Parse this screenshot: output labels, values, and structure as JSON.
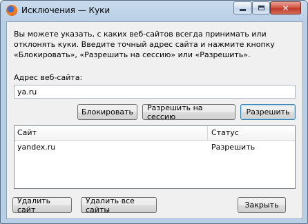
{
  "window": {
    "title": "Исключения — Куки"
  },
  "description": "Вы можете указать, с каких веб-сайтов всегда принимать или отклонять куки. Введите точный адрес сайта и нажмите кнопку «Блокировать», «Разрешить на сессию» или «Разрешить».",
  "address": {
    "label": "Адрес веб-сайта:",
    "value": "ya.ru"
  },
  "buttons": {
    "block": "Блокировать",
    "allow_session": "Разрешить на сессию",
    "allow": "Разрешить",
    "remove_site": "Удалить сайт",
    "remove_all": "Удалить все сайты",
    "close": "Закрыть"
  },
  "table": {
    "columns": [
      "Сайт",
      "Статус"
    ],
    "rows": [
      {
        "site": "yandex.ru",
        "status": "Разрешить"
      }
    ]
  },
  "icons": {
    "app": "firefox-icon",
    "minimize": "minimize-icon",
    "maximize": "maximize-icon",
    "close": "close-icon"
  }
}
